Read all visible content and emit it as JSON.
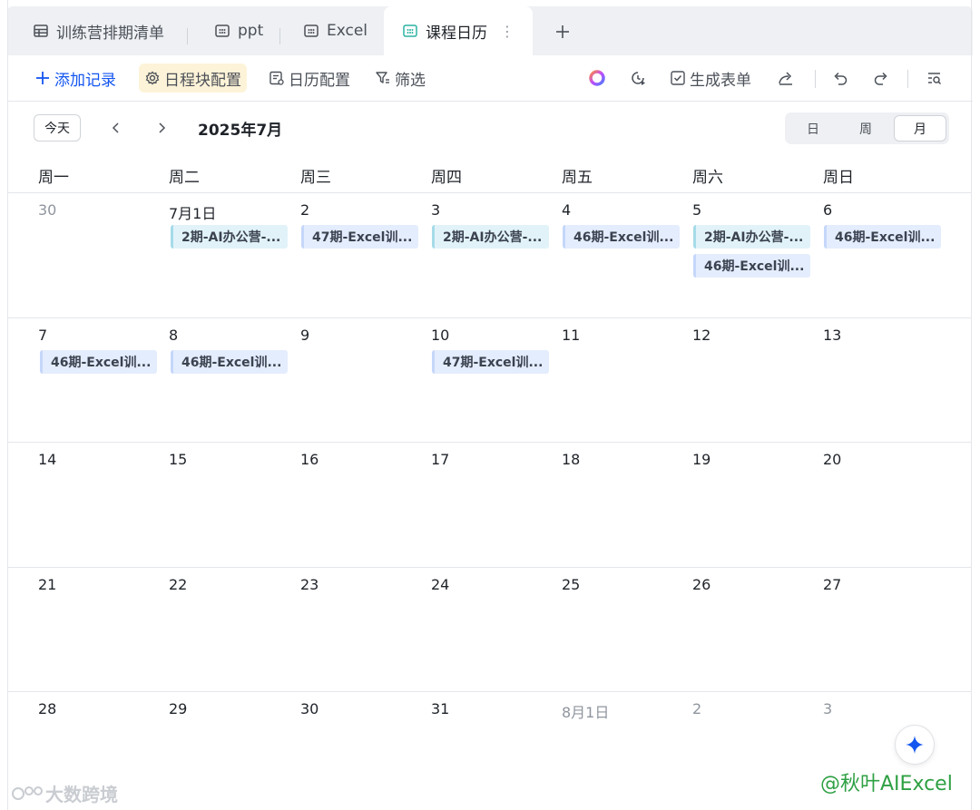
{
  "tabs": [
    {
      "label": "训练营排期清单",
      "icon": "table-icon"
    },
    {
      "label": "ppt",
      "icon": "calendar-grid-icon"
    },
    {
      "label": "Excel",
      "icon": "calendar-grid-icon"
    },
    {
      "label": "课程日历",
      "icon": "calendar-grid-icon",
      "active": true
    }
  ],
  "toolbar": {
    "add_record": "添加记录",
    "block_config": "日程块配置",
    "calendar_config": "日历配置",
    "filter": "筛选",
    "generate_form": "生成表单"
  },
  "calendar": {
    "today": "今天",
    "month_title": "2025年7月",
    "views": [
      "日",
      "周",
      "月"
    ],
    "active_view": "月",
    "weekdays": [
      "周一",
      "周二",
      "周三",
      "周四",
      "周五",
      "周六",
      "周日"
    ],
    "weeks": [
      [
        {
          "label": "30",
          "muted": true,
          "events": []
        },
        {
          "label": "7月1日",
          "events": [
            {
              "title": "2期-AI办公营-...",
              "color": "teal"
            }
          ]
        },
        {
          "label": "2",
          "events": [
            {
              "title": "47期-Excel训...",
              "color": "blue"
            }
          ]
        },
        {
          "label": "3",
          "events": [
            {
              "title": "2期-AI办公营-...",
              "color": "teal"
            }
          ]
        },
        {
          "label": "4",
          "events": [
            {
              "title": "46期-Excel训...",
              "color": "blue"
            }
          ]
        },
        {
          "label": "5",
          "events": [
            {
              "title": "2期-AI办公营-...",
              "color": "teal"
            },
            {
              "title": "46期-Excel训...",
              "color": "blue"
            }
          ]
        },
        {
          "label": "6",
          "events": [
            {
              "title": "46期-Excel训...",
              "color": "blue"
            }
          ]
        }
      ],
      [
        {
          "label": "7",
          "events": [
            {
              "title": "46期-Excel训...",
              "color": "blue"
            }
          ]
        },
        {
          "label": "8",
          "events": [
            {
              "title": "46期-Excel训...",
              "color": "blue"
            }
          ]
        },
        {
          "label": "9",
          "events": []
        },
        {
          "label": "10",
          "events": [
            {
              "title": "47期-Excel训...",
              "color": "blue"
            }
          ]
        },
        {
          "label": "11",
          "events": []
        },
        {
          "label": "12",
          "events": []
        },
        {
          "label": "13",
          "events": []
        }
      ],
      [
        {
          "label": "14",
          "events": []
        },
        {
          "label": "15",
          "events": []
        },
        {
          "label": "16",
          "events": []
        },
        {
          "label": "17",
          "events": []
        },
        {
          "label": "18",
          "events": []
        },
        {
          "label": "19",
          "events": []
        },
        {
          "label": "20",
          "events": []
        }
      ],
      [
        {
          "label": "21",
          "events": []
        },
        {
          "label": "22",
          "events": []
        },
        {
          "label": "23",
          "events": []
        },
        {
          "label": "24",
          "events": []
        },
        {
          "label": "25",
          "events": []
        },
        {
          "label": "26",
          "events": []
        },
        {
          "label": "27",
          "events": []
        }
      ],
      [
        {
          "label": "28",
          "events": []
        },
        {
          "label": "29",
          "events": []
        },
        {
          "label": "30",
          "events": []
        },
        {
          "label": "31",
          "events": []
        },
        {
          "label": "8月1日",
          "muted": true,
          "events": []
        },
        {
          "label": "2",
          "muted": true,
          "events": []
        },
        {
          "label": "3",
          "muted": true,
          "events": []
        }
      ]
    ]
  },
  "watermark": {
    "left": "大数跨境",
    "right": "@秋叶AIExcel"
  },
  "colors": {
    "accent": "#1456f0",
    "event_teal_bg": "#e1f3f9",
    "event_blue_bg": "#e4edfd",
    "block_config_highlight": "#fdf3d8",
    "watermark_green": "#2ea043"
  }
}
